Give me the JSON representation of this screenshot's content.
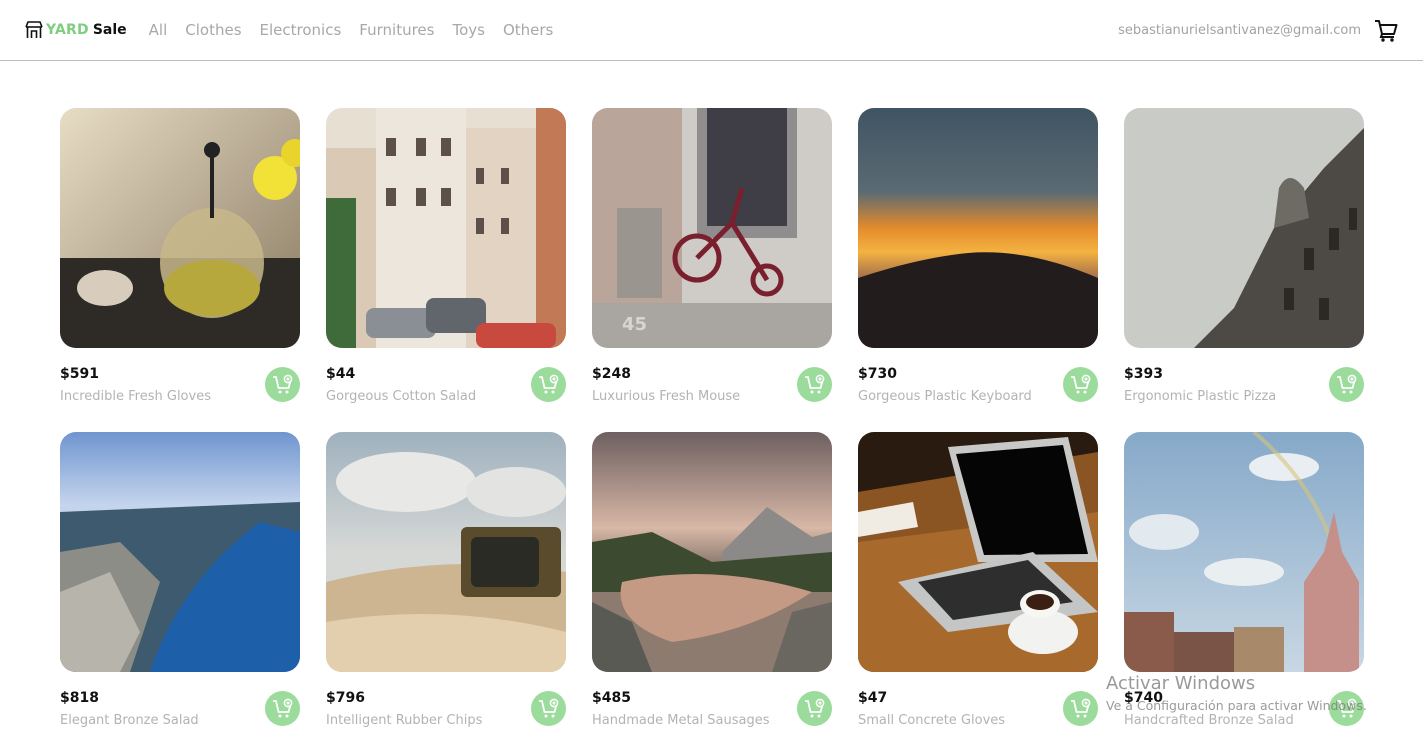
{
  "header": {
    "logo_yard": "YARD",
    "logo_sale": "Sale",
    "nav": [
      "All",
      "Clothes",
      "Electronics",
      "Furnitures",
      "Toys",
      "Others"
    ],
    "user_email": "sebastianurielsantivanez@gmail.com",
    "cart_icon": "shopping-cart-icon"
  },
  "products": [
    {
      "price": "$591",
      "name": "Incredible Fresh Gloves",
      "image": "teapot-photo"
    },
    {
      "price": "$44",
      "name": "Gorgeous Cotton Salad",
      "image": "street-photo"
    },
    {
      "price": "$248",
      "name": "Luxurious Fresh Mouse",
      "image": "tricycle-photo"
    },
    {
      "price": "$730",
      "name": "Gorgeous Plastic Keyboard",
      "image": "sunset-photo"
    },
    {
      "price": "$393",
      "name": "Ergonomic Plastic Pizza",
      "image": "building-photo"
    },
    {
      "price": "$818",
      "name": "Elegant Bronze Salad",
      "image": "fjord-photo"
    },
    {
      "price": "$796",
      "name": "Intelligent Rubber Chips",
      "image": "tv-photo"
    },
    {
      "price": "$485",
      "name": "Handmade Metal Sausages",
      "image": "lake-photo"
    },
    {
      "price": "$47",
      "name": "Small Concrete Gloves",
      "image": "laptop-photo"
    },
    {
      "price": "$740",
      "name": "Handcrafted Bronze Salad",
      "image": "city-photo"
    }
  ],
  "add_button_icon": "cart-plus-icon",
  "watermark": {
    "title": "Activar Windows",
    "subtitle": "Ve a Configuración para activar Windows."
  },
  "colors": {
    "brand_green": "#7fce7f",
    "button_green": "#9bdb9b",
    "muted_text": "#b3b3b3"
  }
}
